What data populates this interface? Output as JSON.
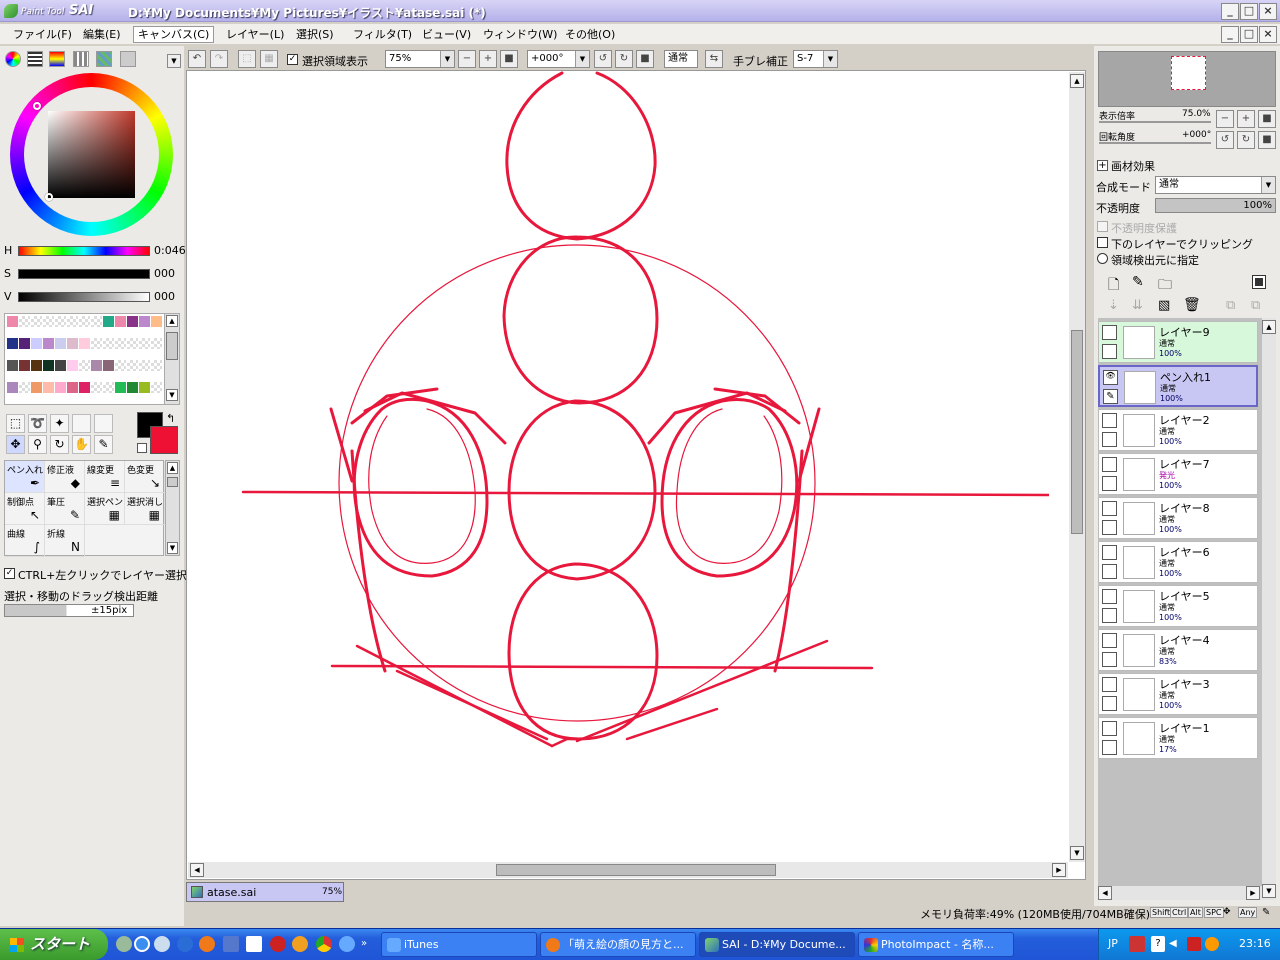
{
  "window": {
    "logo_small": "Paint Tool",
    "logo_big": "SAI",
    "title": "D:¥My Documents¥My Pictures¥イラスト¥atase.sai (*)"
  },
  "menu": [
    "ファイル(F)",
    "編集(E)",
    "キャンバス(C)",
    "レイヤー(L)",
    "選択(S)",
    "フィルタ(T)",
    "ビュー(V)",
    "ウィンドウ(W)",
    "その他(O)"
  ],
  "toolbar": {
    "selection_label": "選択領域表示",
    "zoom": "75%",
    "angle": "+000°",
    "mode": "通常",
    "stabilizer_label": "手ブレ補正",
    "stabilizer": "S-7"
  },
  "color": {
    "h_label": "H",
    "h_value": "0:046",
    "s_label": "S",
    "s_value": "000",
    "v_label": "V",
    "v_value": "000",
    "primary": "#000000",
    "secondary": "#ee1133"
  },
  "palette_colors": [
    "#ee88aa",
    "#ffffff",
    "#ffffff",
    "#ffffff",
    "#ffffff",
    "#ffffff",
    "#ffffff",
    "#ffffff",
    "#22aa88",
    "#ee88aa",
    "#883388",
    "#bb88cc",
    "#ffbb88",
    "#223388",
    "#552277",
    "#ccccff",
    "#bb88cc",
    "#ccccee",
    "#ddbbcc",
    "#ffccdd",
    "#ffffff",
    "#ffffff",
    "#ffffff",
    "#ffffff",
    "#ffffff",
    "#ffffff",
    "#555555",
    "#773333",
    "#553311",
    "#113322",
    "#444444",
    "#ffccee",
    "#ffffff",
    "#aa88aa",
    "#886677",
    "#ffffff",
    "#ffffff",
    "#ffffff",
    "#ffffff",
    "#aa88bb",
    "#ffffff",
    "#ee9966",
    "#ffbbaa",
    "#ffaacc",
    "#dd6688",
    "#dd2266",
    "#ffffff",
    "#ffffff",
    "#22bb55",
    "#228833",
    "#99bb22",
    "#ffffff"
  ],
  "brushes": [
    {
      "name": "ペン入れ",
      "icon": "✒"
    },
    {
      "name": "修正液",
      "icon": "◆"
    },
    {
      "name": "線変更",
      "icon": "≡"
    },
    {
      "name": "色変更",
      "icon": "↘"
    },
    {
      "name": "制御点",
      "icon": "↖"
    },
    {
      "name": "筆圧",
      "icon": "✎"
    },
    {
      "name": "選択ペン",
      "icon": "▦"
    },
    {
      "name": "選択消し",
      "icon": "▦"
    },
    {
      "name": "曲線",
      "icon": "∫"
    },
    {
      "name": "折線",
      "icon": "N"
    }
  ],
  "options": {
    "ctrl_select": "CTRL+左クリックでレイヤー選択",
    "drag_label": "選択・移動のドラッグ検出距離",
    "drag_value": "±15pix"
  },
  "document_tab": {
    "name": "atase.sai",
    "zoom": "75%"
  },
  "status": {
    "memory": "メモリ負荷率:49% (120MB使用/704MB確保)",
    "keys": [
      "Shift",
      "Ctrl",
      "Alt",
      "SPC",
      "Any"
    ]
  },
  "navigator": {
    "zoom_label": "表示倍率",
    "zoom_value": "75.0%",
    "rotate_label": "回転角度",
    "rotate_value": "+000°"
  },
  "layer_props": {
    "effect_label": "画材効果",
    "blend_label": "合成モード",
    "blend_value": "通常",
    "opacity_label": "不透明度",
    "opacity_value": "100%",
    "protect_label": "不透明度保護",
    "clip_label": "下のレイヤーでクリッピング",
    "source_label": "領域検出元に指定"
  },
  "layers": [
    {
      "name": "レイヤー9",
      "mode": "通常",
      "opacity": "100%",
      "state": "highlight"
    },
    {
      "name": "ペン入れ1",
      "mode": "通常",
      "opacity": "100%",
      "state": "selected"
    },
    {
      "name": "レイヤー2",
      "mode": "通常",
      "opacity": "100%",
      "state": "normal"
    },
    {
      "name": "レイヤー7",
      "mode": "発光",
      "opacity": "100%",
      "state": "normal"
    },
    {
      "name": "レイヤー8",
      "mode": "通常",
      "opacity": "100%",
      "state": "normal"
    },
    {
      "name": "レイヤー6",
      "mode": "通常",
      "opacity": "100%",
      "state": "normal"
    },
    {
      "name": "レイヤー5",
      "mode": "通常",
      "opacity": "100%",
      "state": "normal"
    },
    {
      "name": "レイヤー4",
      "mode": "通常",
      "opacity": "83%",
      "state": "normal"
    },
    {
      "name": "レイヤー3",
      "mode": "通常",
      "opacity": "100%",
      "state": "normal"
    },
    {
      "name": "レイヤー1",
      "mode": "通常",
      "opacity": "17%",
      "state": "normal"
    }
  ],
  "taskbar": {
    "start": "スタート",
    "tasks": [
      {
        "label": "iTunes",
        "active": false
      },
      {
        "label": "「萌え絵の顔の見方と...",
        "active": false
      },
      {
        "label": "SAI - D:¥My Docume...",
        "active": true
      },
      {
        "label": "PhotoImpact - 名称...",
        "active": false
      }
    ],
    "lang": "JP",
    "clock": "23:16"
  }
}
